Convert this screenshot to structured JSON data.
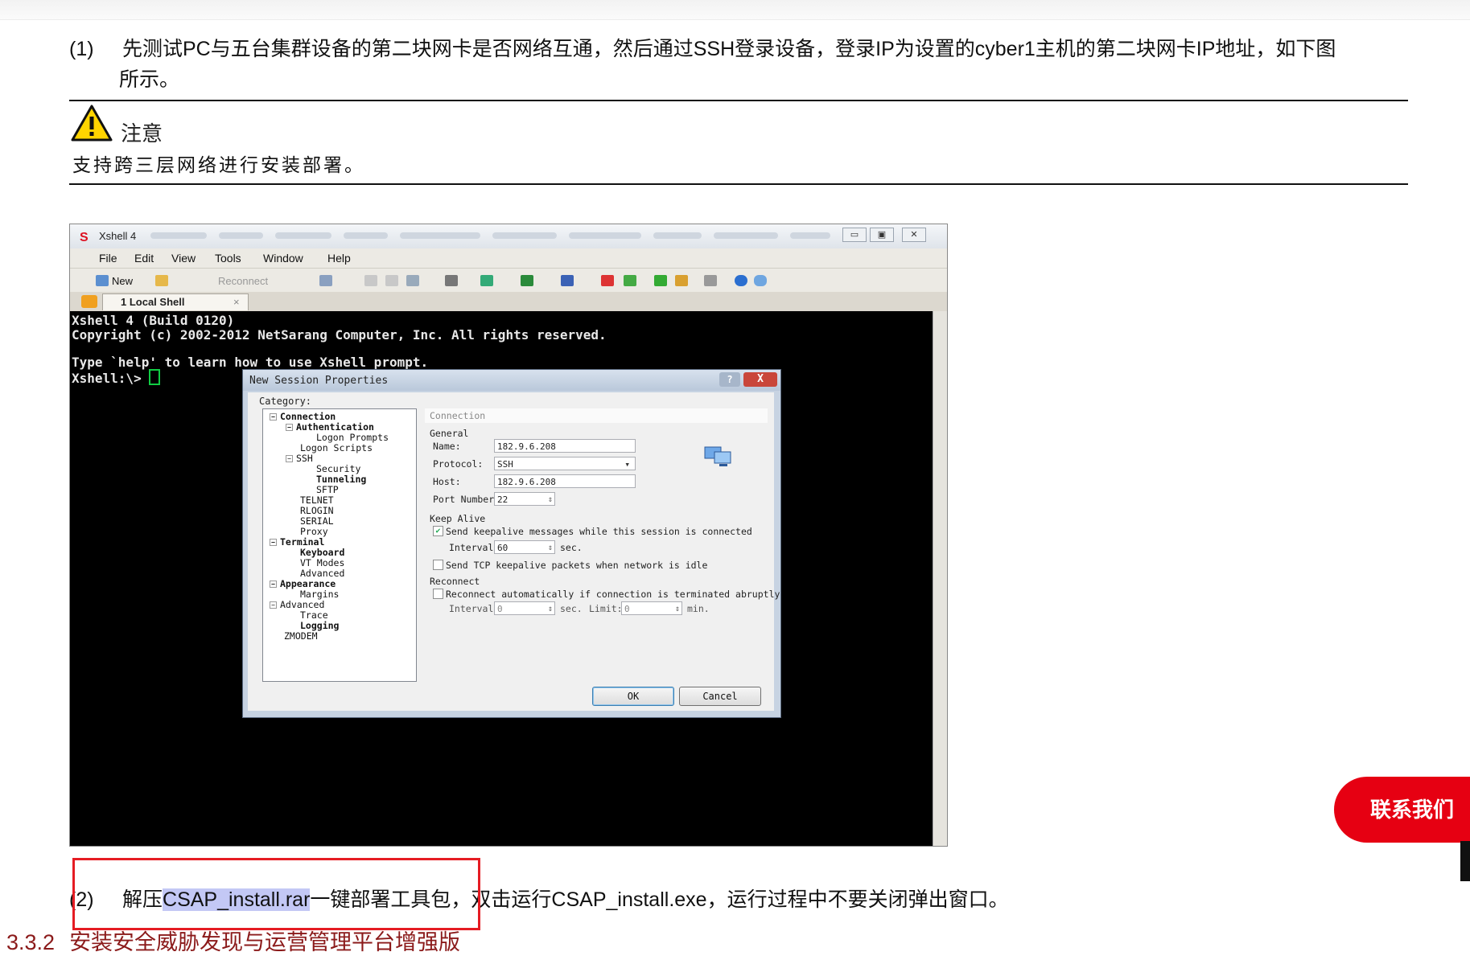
{
  "step1": {
    "num": "(1)",
    "line1": "先测试PC与五台集群设备的第二块网卡是否网络互通，然后通过SSH登录设备，登录IP为设置的cyber1主机的第二块网卡IP地址，如下图",
    "line2": "所示。"
  },
  "note": {
    "title": "注意",
    "body": "支持跨三层网络进行安装部署。"
  },
  "screenshot": {
    "window_title": "Xshell 4",
    "menu": [
      "File",
      "Edit",
      "View",
      "Tools",
      "Window",
      "Help"
    ],
    "toolbar": {
      "new_label": "New",
      "reconnect_label": "Reconnect"
    },
    "tab_label": "1 Local Shell",
    "terminal_lines": [
      "Xshell 4 (Build 0120)",
      "Copyright (c) 2002-2012 NetSarang Computer, Inc. All rights reserved.",
      "Type `help' to learn how to use Xshell prompt.",
      "Xshell:\\> "
    ],
    "dialog": {
      "title": "New Session Properties",
      "help_label": "?",
      "close_label": "X",
      "category_label": "Category:",
      "tree": [
        {
          "label": "Connection",
          "bold": true
        },
        {
          "label": "Authentication",
          "bold": true
        },
        {
          "label": "Logon Prompts",
          "bold": false
        },
        {
          "label": "Logon Scripts",
          "bold": false
        },
        {
          "label": "SSH",
          "bold": false
        },
        {
          "label": "Security",
          "bold": false
        },
        {
          "label": "Tunneling",
          "bold": true
        },
        {
          "label": "SFTP",
          "bold": false
        },
        {
          "label": "TELNET",
          "bold": false
        },
        {
          "label": "RLOGIN",
          "bold": false
        },
        {
          "label": "SERIAL",
          "bold": false
        },
        {
          "label": "Proxy",
          "bold": false
        },
        {
          "label": "Terminal",
          "bold": true
        },
        {
          "label": "Keyboard",
          "bold": true
        },
        {
          "label": "VT Modes",
          "bold": false
        },
        {
          "label": "Advanced",
          "bold": false
        },
        {
          "label": "Appearance",
          "bold": true
        },
        {
          "label": "Margins",
          "bold": false
        },
        {
          "label": "Advanced",
          "bold": false
        },
        {
          "label": "Trace",
          "bold": false
        },
        {
          "label": "Logging",
          "bold": true
        },
        {
          "label": "ZMODEM",
          "bold": false
        }
      ],
      "panel_header": "Connection",
      "general_label": "General",
      "name_label": "Name:",
      "name_value": "182.9.6.208",
      "protocol_label": "Protocol:",
      "protocol_value": "SSH",
      "host_label": "Host:",
      "host_value": "182.9.6.208",
      "port_label": "Port Number:",
      "port_value": "22",
      "keepalive_label": "Keep Alive",
      "keepalive_check": "Send keepalive messages while this session is connected",
      "interval_label": "Interval:",
      "interval_value": "60",
      "sec_label": "sec.",
      "tcp_check": "Send TCP keepalive packets when network is idle",
      "reconnect_label": "Reconnect",
      "reconnect_check": "Reconnect automatically if connection is terminated abruptly",
      "reconnect_interval_label": "Interval:",
      "reconnect_interval_value": "0",
      "reconnect_sec_label": "sec.",
      "limit_label": "Limit:",
      "limit_value": "0",
      "min_label": "min.",
      "ok_label": "OK",
      "cancel_label": "Cancel"
    }
  },
  "step2": {
    "num": "(2)",
    "pre": "解压",
    "highlight": "CSAP_install.rar",
    "post": "一键部署工具包，双击运行CSAP_install.exe，运行过程中不要关闭弹出窗口。"
  },
  "section": {
    "number": "3.3.2",
    "title": "安装安全威胁发现与运营管理平台增强版"
  },
  "contact_label": "联系我们",
  "colors": {
    "accent_red": "#e60012",
    "heading_red": "#8b1a1a",
    "highlight": "#c3c8f5"
  }
}
